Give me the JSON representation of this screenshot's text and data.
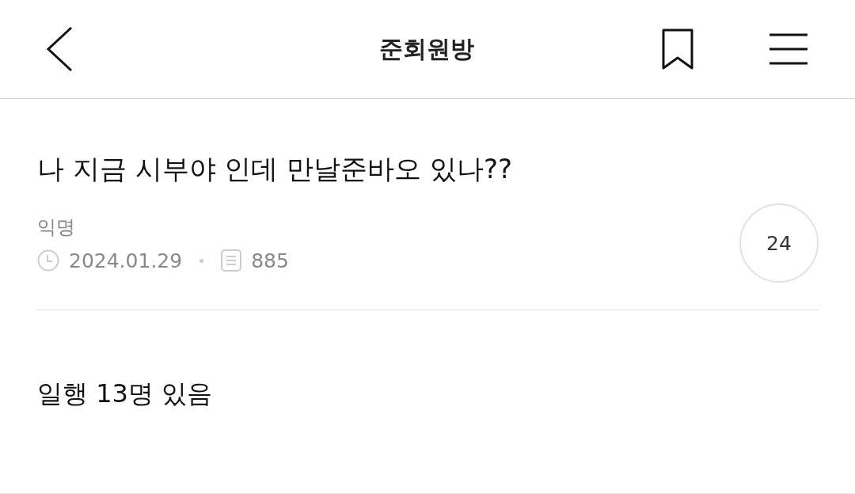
{
  "header": {
    "title": "준회원방",
    "bookmarked": false
  },
  "post": {
    "title": "나 지금 시부야 인데 만날준바오 있나??",
    "author": "익명",
    "date": "2024.01.29",
    "views": "885",
    "comment_count": "24",
    "body": "일행 13명 있음"
  }
}
